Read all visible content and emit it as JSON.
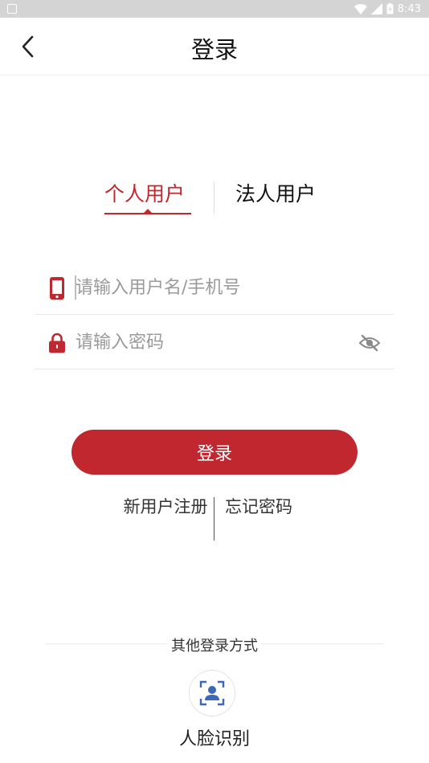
{
  "status_bar": {
    "time": "8:43"
  },
  "header": {
    "title": "登录"
  },
  "tabs": [
    {
      "label": "个人用户",
      "active": true
    },
    {
      "label": "法人用户",
      "active": false
    }
  ],
  "form": {
    "username": {
      "value": "",
      "placeholder": "请输入用户名/手机号"
    },
    "password": {
      "value": "",
      "placeholder": "请输入密码"
    }
  },
  "login_button": {
    "label": "登录"
  },
  "links": {
    "register": "新用户注册",
    "forgot": "忘记密码"
  },
  "other": {
    "label": "其他登录方式",
    "face_label": "人脸识别"
  },
  "colors": {
    "accent": "#c0272f",
    "face_icon": "#3d67b8",
    "status_bar": "#d4d4d4"
  }
}
